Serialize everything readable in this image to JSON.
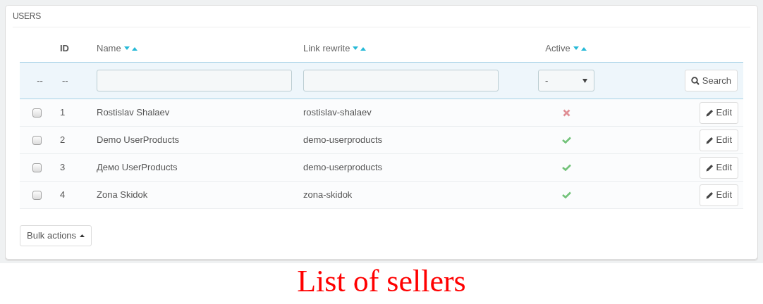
{
  "panel": {
    "title": "USERS"
  },
  "table": {
    "columns": [
      {
        "label": "ID",
        "sortable": false
      },
      {
        "label": "Name",
        "sortable": true
      },
      {
        "label": "Link rewrite",
        "sortable": true
      },
      {
        "label": "Active",
        "sortable": true
      }
    ],
    "filter": {
      "checkbox_cell": "--",
      "id_cell": "--",
      "active_select": {
        "value": "-"
      },
      "search_button": "Search"
    },
    "rows": [
      {
        "checked": false,
        "id": "1",
        "name": "Rostislav Shalaev",
        "link_rewrite": "rostislav-shalaev",
        "active": false,
        "action": "Edit"
      },
      {
        "checked": false,
        "id": "2",
        "name": "Demo UserProducts",
        "link_rewrite": "demo-userproducts",
        "active": true,
        "action": "Edit"
      },
      {
        "checked": false,
        "id": "3",
        "name": "Демо UserProducts",
        "link_rewrite": "demo-userproducts",
        "active": true,
        "action": "Edit"
      },
      {
        "checked": false,
        "id": "4",
        "name": "Zona Skidok",
        "link_rewrite": "zona-skidok",
        "active": true,
        "action": "Edit"
      }
    ]
  },
  "bulk_button": "Bulk actions",
  "caption": "List of sellers"
}
